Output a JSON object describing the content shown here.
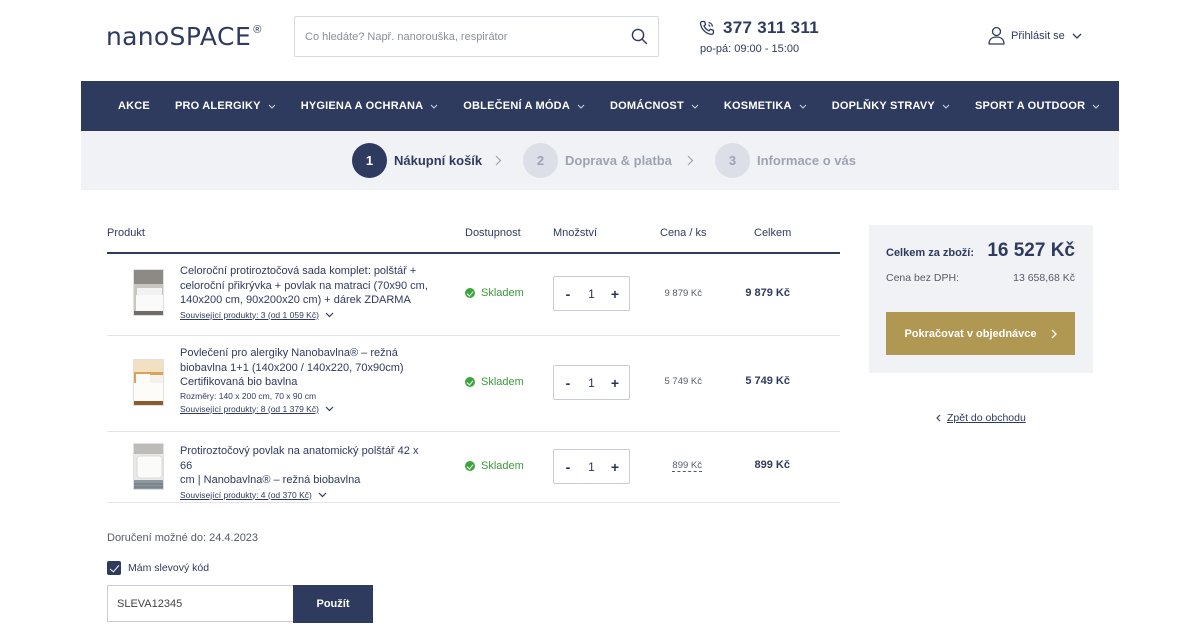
{
  "header": {
    "logo_nano": "nano",
    "logo_space": "SPACE",
    "logo_reg": "®",
    "search_placeholder": "Co hledáte? Např. nanorouška, respirátor",
    "phone": "377 311 311",
    "hours": "po-pá: 09:00 - 15:00",
    "login": "Přihlásit se"
  },
  "nav": {
    "items": [
      {
        "label": "AKCE",
        "dropdown": false
      },
      {
        "label": "PRO ALERGIKY",
        "dropdown": true
      },
      {
        "label": "HYGIENA A OCHRANA",
        "dropdown": true
      },
      {
        "label": "OBLEČENÍ A MÓDA",
        "dropdown": true
      },
      {
        "label": "DOMÁCNOST",
        "dropdown": true
      },
      {
        "label": "KOSMETIKA",
        "dropdown": true
      },
      {
        "label": "DOPLŇKY STRAVY",
        "dropdown": true
      },
      {
        "label": "SPORT A OUTDOOR",
        "dropdown": true
      }
    ]
  },
  "steps": [
    {
      "number": "1",
      "label": "Nákupní košík",
      "active": true
    },
    {
      "number": "2",
      "label": "Doprava & platba",
      "active": false
    },
    {
      "number": "3",
      "label": "Informace o vás",
      "active": false
    }
  ],
  "table": {
    "headers": {
      "product": "Produkt",
      "availability": "Dostupnost",
      "quantity": "Množství",
      "unit_price": "Cena / ks",
      "total": "Celkem"
    },
    "rows": [
      {
        "name_lines": [
          "Celoroční protiroztočová sada komplet: polštář +",
          "celoroční přikrývka + povlak na matraci (70x90 cm,",
          "140x200 cm, 90x200x20 cm) + dárek ZDARMA"
        ],
        "meta": "",
        "related": "Související produkty: 3 (od 1 059 Kč)",
        "availability": "Skladem",
        "qty": "1",
        "minus": "-",
        "plus": "+",
        "unit_price": "9 879 Kč",
        "total": "9 879 Kč"
      },
      {
        "name_lines": [
          "Povlečení pro alergiky Nanobavlna® – režná",
          "biobavlna 1+1 (140x200 / 140x220, 70x90cm)",
          "Certifikovaná bio bavlna"
        ],
        "meta": "Rozměry: 140 x 200 cm, 70 x 90 cm",
        "related": "Související produkty: 8 (od 1 379 Kč)",
        "availability": "Skladem",
        "qty": "1",
        "minus": "-",
        "plus": "+",
        "unit_price": "5 749 Kč",
        "total": "5 749 Kč"
      },
      {
        "name_lines": [
          "Protiroztočový povlak na anatomický polštář 42 x 66",
          "cm | Nanobavlna® – režná biobavlna"
        ],
        "meta": "",
        "related": "Související produkty: 4 (od 370 Kč)",
        "availability": "Skladem",
        "qty": "1",
        "minus": "-",
        "plus": "+",
        "unit_price": "899 Kč",
        "total": "899 Kč"
      }
    ]
  },
  "delivery": "Doručení možné do: 24.4.2023",
  "coupon": {
    "checkbox_label": "Mám slevový kód",
    "checked": true,
    "value": "SLEVA12345",
    "apply": "Použít"
  },
  "summary": {
    "total_label": "Celkem za zboží:",
    "total_value": "16 527 Kč",
    "net_label": "Cena bez DPH:",
    "net_value": "13 658,68 Kč",
    "cta": "Pokračovat v objednávce",
    "back": "Zpět do obchodu"
  },
  "colors": {
    "navy": "#2f3b5e",
    "gold": "#b09853",
    "panel": "#f1f2f6",
    "in_stock": "#3aa53a"
  }
}
